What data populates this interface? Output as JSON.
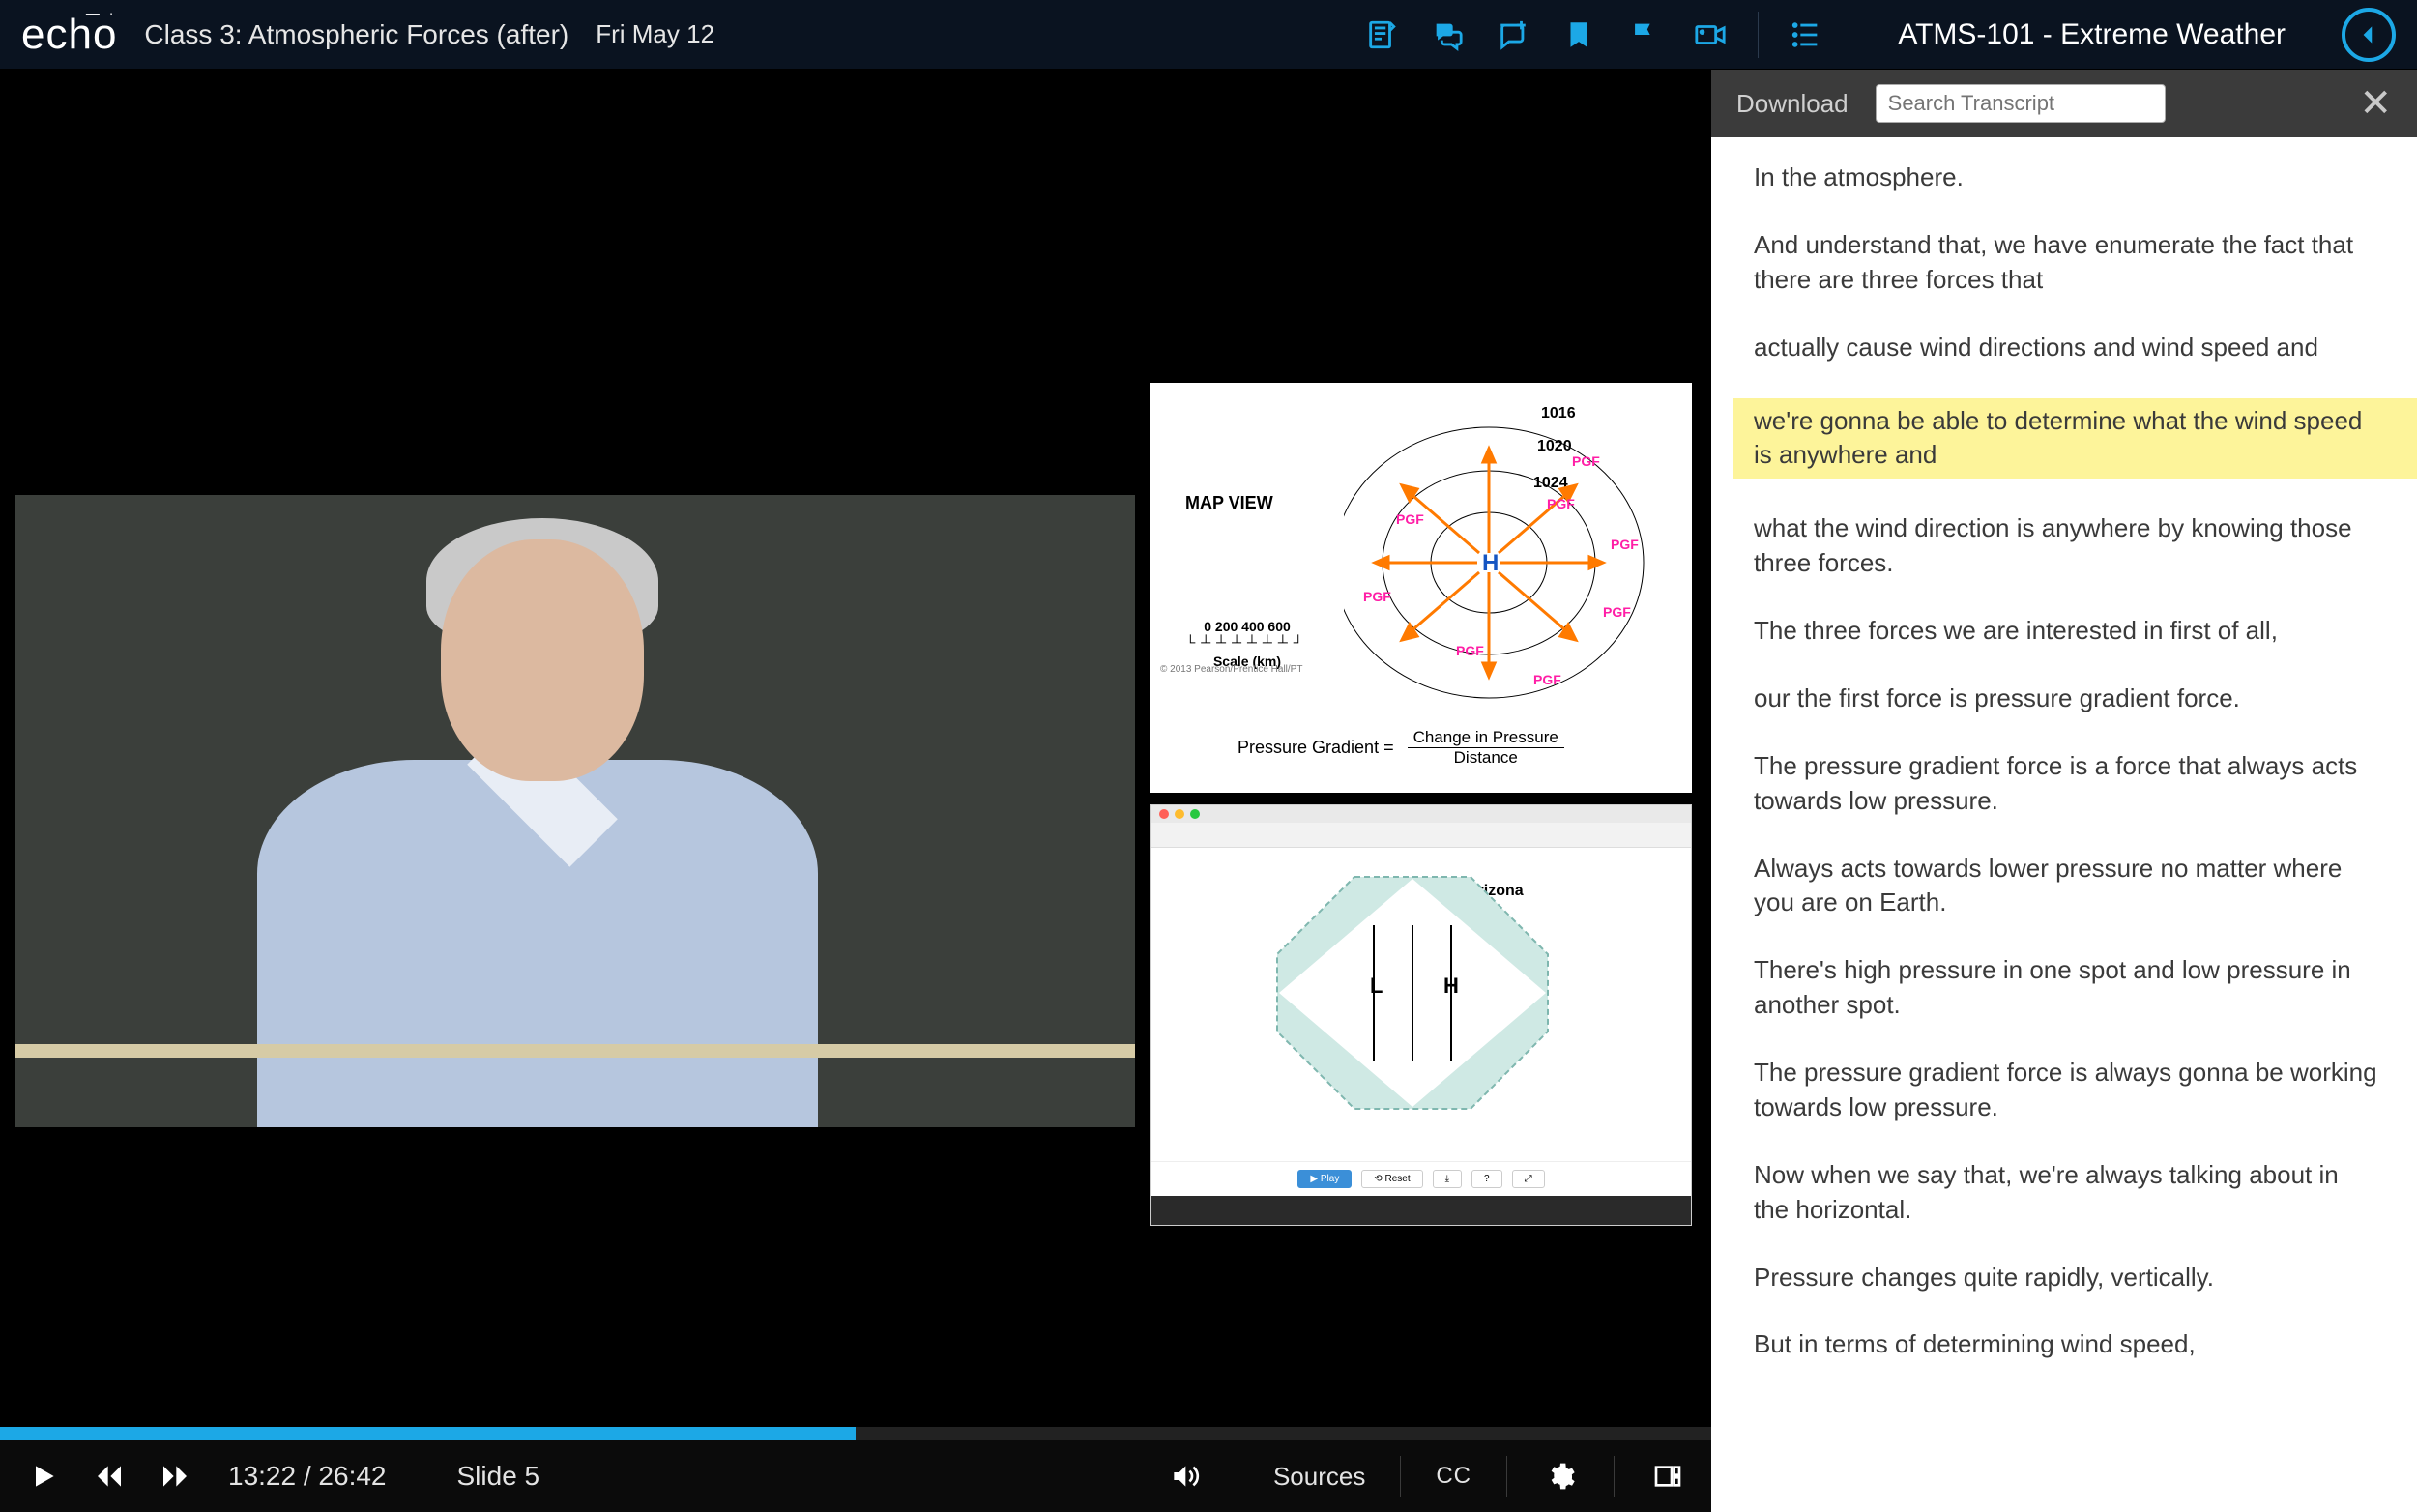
{
  "brand": "echo",
  "header": {
    "class_title": "Class 3: Atmospheric Forces (after)",
    "class_date": "Fri May 12",
    "course_title": "ATMS-101 - Extreme Weather"
  },
  "top_icons": [
    {
      "name": "notes-icon"
    },
    {
      "name": "discussion-icon"
    },
    {
      "name": "add-note-icon"
    },
    {
      "name": "bookmark-icon"
    },
    {
      "name": "flag-icon"
    },
    {
      "name": "camera-feed-icon"
    },
    {
      "name": "outline-icon"
    }
  ],
  "transcript": {
    "download_label": "Download",
    "search_placeholder": "Search Transcript",
    "lines": [
      {
        "text": "In the atmosphere.",
        "highlight": false
      },
      {
        "text": "And understand that, we have enumerate the fact that there are three forces that",
        "highlight": false
      },
      {
        "text": "actually cause wind directions and wind speed and",
        "highlight": false
      },
      {
        "text": "we're gonna be able to determine what the wind speed is anywhere and",
        "highlight": true
      },
      {
        "text": "what the wind direction is anywhere by knowing those three forces.",
        "highlight": false
      },
      {
        "text": "The three forces we are interested in first of all,",
        "highlight": false
      },
      {
        "text": "our the first force is pressure gradient force.",
        "highlight": false
      },
      {
        "text": "The pressure gradient force is a force that always acts towards low pressure.",
        "highlight": false
      },
      {
        "text": "Always acts towards lower pressure no matter where you are on Earth.",
        "highlight": false
      },
      {
        "text": "There's high pressure in one spot and low pressure in another spot.",
        "highlight": false
      },
      {
        "text": "The pressure gradient force is always gonna be working towards low pressure.",
        "highlight": false
      },
      {
        "text": "Now when we say that, we're always talking about in the horizontal.",
        "highlight": false
      },
      {
        "text": "Pressure changes quite rapidly, vertically.",
        "highlight": false
      },
      {
        "text": "But in terms of determining wind speed,",
        "highlight": false
      }
    ]
  },
  "slide_a": {
    "title": "MAP VIEW",
    "isobars": [
      "1016",
      "1020",
      "1024"
    ],
    "center_label": "H",
    "arrow_label": "PGF",
    "scale_values": "0  200 400 600",
    "scale_label": "Scale (km)",
    "formula_lhs": "Pressure Gradient  =",
    "formula_top": "Change in Pressure",
    "formula_bot": "Distance"
  },
  "slide_b": {
    "region": "Arizona",
    "L": "L",
    "H": "H"
  },
  "player": {
    "current_time": "13:22",
    "duration": "26:42",
    "progress_pct": 50,
    "slide_label": "Slide 5",
    "sources_label": "Sources",
    "cc_label": "CC"
  }
}
